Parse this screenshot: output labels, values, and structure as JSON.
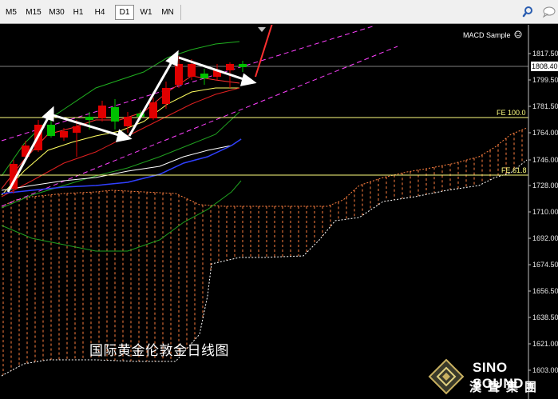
{
  "toolbar": {
    "timeframes": [
      {
        "label": "M5",
        "active": false
      },
      {
        "label": "M15",
        "active": false
      },
      {
        "label": "M30",
        "active": false
      },
      {
        "label": "H1",
        "active": false
      },
      {
        "label": "H4",
        "active": false
      },
      {
        "label": "D1",
        "active": true
      },
      {
        "label": "W1",
        "active": false
      },
      {
        "label": "MN",
        "active": false
      }
    ],
    "icons": [
      "search-icon",
      "chat-icon"
    ]
  },
  "chart": {
    "indicator_label": "MACD Sample",
    "current_price": "1808.40",
    "fib_levels": [
      {
        "label": "FE 100.0",
        "color": "#ffff80"
      },
      {
        "label": "FE 61.8",
        "color": "#ffff80"
      }
    ],
    "price_axis": [
      "1817.50",
      "1799.50",
      "1781.50",
      "1764.00",
      "1746.00",
      "1728.00",
      "1710.00",
      "1692.00",
      "1674.50",
      "1656.50",
      "1638.50",
      "1621.00",
      "1603.00"
    ],
    "caption": "国际黄金伦敦金日线图",
    "colors": {
      "bull_candle": "#00c000",
      "bear_candle": "#e00000",
      "cloud_upper": "#ff8040",
      "cloud_lower": "#ffffff",
      "channel": "#ff40ff",
      "arrow_white": "#ffffff",
      "arrow_red": "#ff3030"
    }
  },
  "logo": {
    "name_en": "SINO SOUND",
    "name_cn": "漢聲集團"
  }
}
